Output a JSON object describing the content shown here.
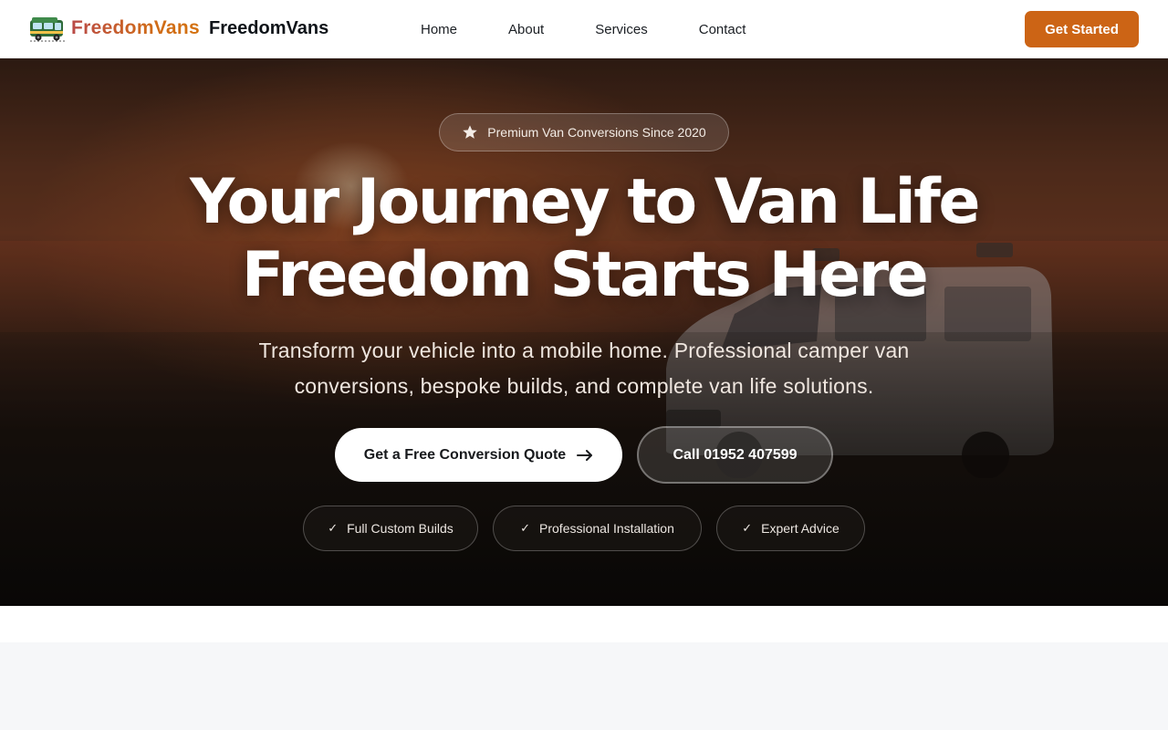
{
  "brand": {
    "name_gradient": "FreedomVans",
    "name_plain": "FreedomVans",
    "logo_icon": "camper-van-icon",
    "gradient_colors": [
      "#b94a48",
      "#d4720f"
    ]
  },
  "nav": {
    "links": [
      {
        "label": "Home"
      },
      {
        "label": "About"
      },
      {
        "label": "Services"
      },
      {
        "label": "Contact"
      }
    ],
    "cta_label": "Get Started"
  },
  "hero": {
    "badge_icon": "star-icon",
    "badge_text": "Premium Van Conversions Since 2020",
    "headline_line1": "Your Journey to Van Life",
    "headline_line2": "Freedom Starts Here",
    "subtitle": "Transform your vehicle into a mobile home. Professional camper van conversions, bespoke builds, and complete van life solutions.",
    "primary_button": {
      "label": "Get a Free Conversion Quote",
      "icon": "arrow-right-icon"
    },
    "secondary_button": {
      "label": "Call 01952 407599"
    },
    "features": [
      {
        "icon": "check-icon",
        "check": "✓",
        "label": "Full Custom Builds"
      },
      {
        "icon": "check-icon",
        "check": "✓",
        "label": "Professional Installation"
      },
      {
        "icon": "check-icon",
        "check": "✓",
        "label": "Expert Advice"
      }
    ]
  },
  "colors": {
    "accent": "#cc6415",
    "nav_text": "#1b1f24",
    "page_bg_lower": "#f6f7f9"
  }
}
